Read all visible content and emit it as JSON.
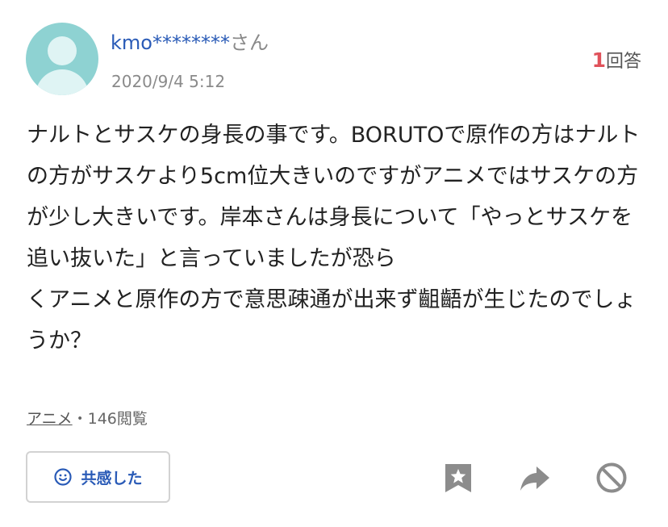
{
  "header": {
    "user_handle": "kmo********",
    "user_suffix": "さん",
    "date": "2020/9/4 5:12",
    "answer_count": "1",
    "answer_label": "回答"
  },
  "question": {
    "paragraphs": [
      "ナルトとサスケの身長の事です。BORUTOで原作の方はナルトの方がサスケより5cm位大きいのですがアニメではサスケの方が少し大きいです。岸本さんは身長について「やっとサスケを追い抜いた」と言っていましたが恐ら",
      "くアニメと原作の方で意思疎通が出来ず齟齬が生じたのでしょうか？"
    ]
  },
  "meta": {
    "category": "アニメ",
    "views": "・146閲覧"
  },
  "actions": {
    "empathy_label": "共感した",
    "empathy_icon": "smile-icon",
    "bookmark_icon": "bookmark-star-icon",
    "share_icon": "share-arrow-icon",
    "report_icon": "prohibited-icon"
  },
  "colors": {
    "link_blue": "#2a5bb7",
    "answer_count_red": "#e0525b",
    "avatar_teal": "#8ed2d2",
    "icon_gray": "#8c8c8c"
  }
}
